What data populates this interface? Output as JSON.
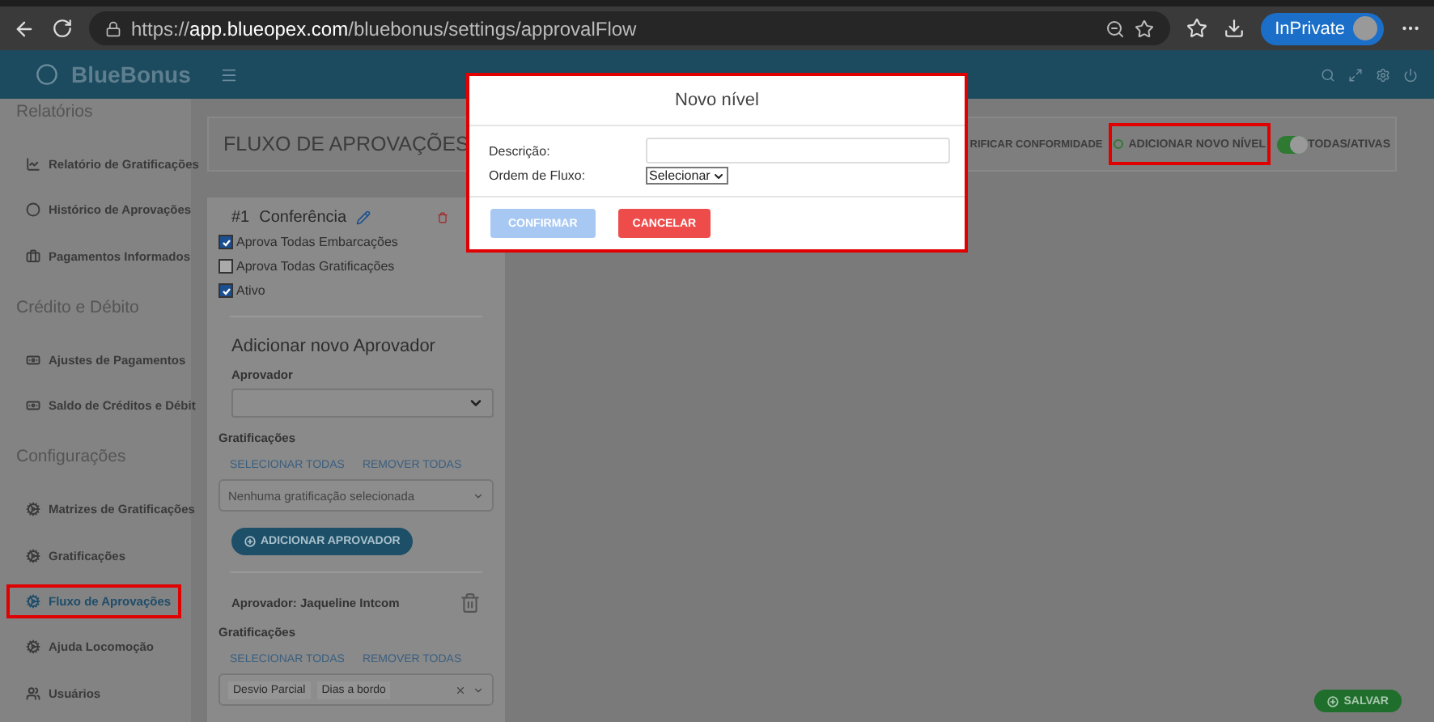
{
  "browser": {
    "url": "https://**app.blueopex.com**/bluebonus/settings/approvalFlow",
    "profile_label": "InPrivate"
  },
  "app": {
    "brand": "BlueBonus"
  },
  "sidebar": {
    "sections": [
      {
        "title": "Relatórios",
        "items": [
          {
            "label": "Relatório de Gratificações",
            "kind": "chart",
            "selected": false,
            "highlighted": false
          },
          {
            "label": "Histórico de Aprovações",
            "kind": "circle",
            "selected": false,
            "highlighted": false
          },
          {
            "label": "Pagamentos Informados",
            "kind": "briefcase",
            "selected": false,
            "highlighted": false
          }
        ]
      },
      {
        "title": "Crédito e Débito",
        "items": [
          {
            "label": "Ajustes de Pagamentos",
            "kind": "money",
            "selected": false,
            "highlighted": false
          },
          {
            "label": "Saldo de Créditos e Débit",
            "kind": "money",
            "selected": false,
            "highlighted": false
          }
        ]
      },
      {
        "title": "Configurações",
        "items": [
          {
            "label": "Matrizes de Gratificações",
            "kind": "cogs",
            "selected": false,
            "highlighted": false
          },
          {
            "label": "Gratificações",
            "kind": "cogs",
            "selected": false,
            "highlighted": false
          },
          {
            "label": "Fluxo de Aprovações",
            "kind": "cogs",
            "selected": true,
            "highlighted": true
          },
          {
            "label": "Ajuda Locomoção",
            "kind": "cogs",
            "selected": false,
            "highlighted": false
          },
          {
            "label": "Usuários",
            "kind": "users",
            "selected": false,
            "highlighted": false
          }
        ]
      }
    ]
  },
  "page_title": "FLUXO DE APROVAÇÕES",
  "toolbar": {
    "verify_label": "RIFICAR CONFORMIDADE",
    "add_level": {
      "label": "ADICIONAR NOVO NÍVEL",
      "highlighted": true
    },
    "toggle": {
      "label": "TODAS/ATIVAS",
      "on": true
    }
  },
  "level": {
    "number": "#1",
    "name": "Conferência",
    "options": [
      {
        "label": "Aprova Todas Embarcações",
        "checked": true
      },
      {
        "label": "Aprova Todas Gratificações",
        "checked": false
      },
      {
        "label": "Ativo",
        "checked": true
      }
    ],
    "add_approver": {
      "title": "Adicionar novo Aprovador",
      "approver_label": "Aprovador",
      "gratifications_label": "Gratificações",
      "select_all": "SELECIONAR TODAS",
      "remove_all": "REMOVER TODAS",
      "placeholder": "Nenhuma gratificação selecionada",
      "button": "ADICIONAR APROVADOR"
    },
    "approvers": [
      {
        "name": "Aprovador: Jaqueline Intcom",
        "gratifications_label": "Gratificações",
        "select_all": "SELECIONAR TODAS",
        "remove_all": "REMOVER TODAS",
        "tags": [
          "Desvio Parcial",
          "Dias a bordo"
        ]
      }
    ]
  },
  "save_button": "SALVAR",
  "modal": {
    "title": "Novo nível",
    "highlighted": true,
    "fields": [
      {
        "label": "Descrição:",
        "kind": "text"
      },
      {
        "label": "Ordem de Fluxo:",
        "kind": "select",
        "value": "Selecionar"
      }
    ],
    "confirm": {
      "label": "CONFIRMAR",
      "disabled": true
    },
    "cancel": "CANCELAR"
  }
}
